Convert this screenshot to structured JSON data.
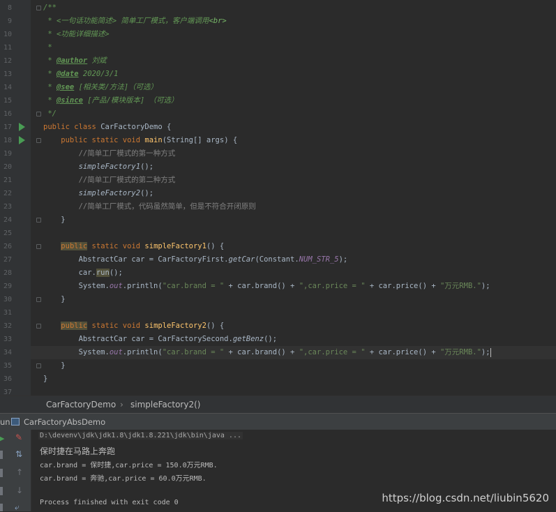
{
  "line_numbers": [
    "8",
    "9",
    "10",
    "11",
    "12",
    "13",
    "14",
    "15",
    "16",
    "17",
    "18",
    "19",
    "20",
    "21",
    "22",
    "23",
    "24",
    "25",
    "26",
    "27",
    "28",
    "29",
    "30",
    "31",
    "32",
    "33",
    "34",
    "35",
    "36",
    "37"
  ],
  "code": {
    "l8": "/**",
    "l9_star": " * ",
    "l9_text": "<一句话功能简述> 简单工厂模式，客户端调用",
    "l9_tag": "<br>",
    "l10": " * <功能详细描述>",
    "l11": " *",
    "l12_star": " * ",
    "l12_tag": "@author",
    "l12_val": " 刘斌",
    "l13_tag": "@date",
    "l13_val": " 2020/3/1",
    "l14_tag": "@see",
    "l14_val": " [相关类/方法]（可选）",
    "l15_tag": "@since",
    "l15_val": " [产品/模块版本] （可选）",
    "l16": " */",
    "l17_kw": "public class ",
    "l17_rest": "CarFactoryDemo {",
    "l18_kw": "    public static void ",
    "l18_fn": "main",
    "l18_rest": "(String[] args) {",
    "l19": "        //简单工厂模式的第一种方式",
    "l20_call": "simpleFactory1",
    "l20_rest": "();",
    "l21": "        //简单工厂模式的第二种方式",
    "l22_call": "simpleFactory2",
    "l22_rest": "();",
    "l23": "        //简单工厂模式，代码虽然简单，但是不符合开闭原则",
    "l24": "    }",
    "l26_kw1": "public",
    "l26_kw2": " static void ",
    "l26_fn": "simpleFactory1",
    "l26_rest": "() {",
    "l27_a": "        AbstractCar car = CarFactoryFirst.",
    "l27_b": "getCar",
    "l27_c": "(Constant.",
    "l27_d": "NUM_STR_5",
    "l27_e": ");",
    "l28_a": "        car.",
    "l28_b": "run",
    "l28_c": "();",
    "l29_a": "        System.",
    "l29_b": "out",
    "l29_c": ".println(",
    "l29_d": "\"car.brand = \"",
    "l29_e": " + car.brand() + ",
    "l29_f": "\",car.price = \"",
    "l29_g": " + car.price() + ",
    "l29_h": "\"万元RMB.\"",
    "l29_i": ");",
    "l30": "    }",
    "l32_kw1": "public",
    "l32_kw2": " static void ",
    "l32_fn": "simpleFactory2",
    "l32_rest": "() {",
    "l33_a": "        AbstractCar car = CarFactorySecond.",
    "l33_b": "getBenz",
    "l33_c": "();",
    "l34_a": "        System.",
    "l34_b": "out",
    "l34_c": ".println(",
    "l34_d": "\"car.brand = \"",
    "l34_e": " + car.brand() + ",
    "l34_f": "\",car.price = \"",
    "l34_g": " + car.price() + ",
    "l34_h": "\"万元RMB.\"",
    "l34_i": ");",
    "l35": "    }",
    "l36": "}"
  },
  "breadcrumb": {
    "class": "CarFactoryDemo",
    "separator": "›",
    "method": "simpleFactory2()"
  },
  "run_panel": {
    "label": "un",
    "config": "CarFactoryAbsDemo",
    "command": "D:\\devenv\\jdk\\jdk1.8\\jdk1.8.221\\jdk\\bin\\java ...",
    "out1": "保时捷在马路上奔跑",
    "out2": "car.brand = 保时捷,car.price = 150.0万元RMB.",
    "out3": "car.brand = 奔驰,car.price = 60.0万元RMB.",
    "out4": "Process finished with exit code 0"
  },
  "watermark": "https://blog.csdn.net/liubin5620",
  "colors": {
    "editor_bg": "#2b2b2b",
    "keyword": "#cc7832",
    "method": "#ffc66d",
    "string": "#6a8759",
    "doc_comment": "#629755",
    "run_green": "#499c54"
  }
}
